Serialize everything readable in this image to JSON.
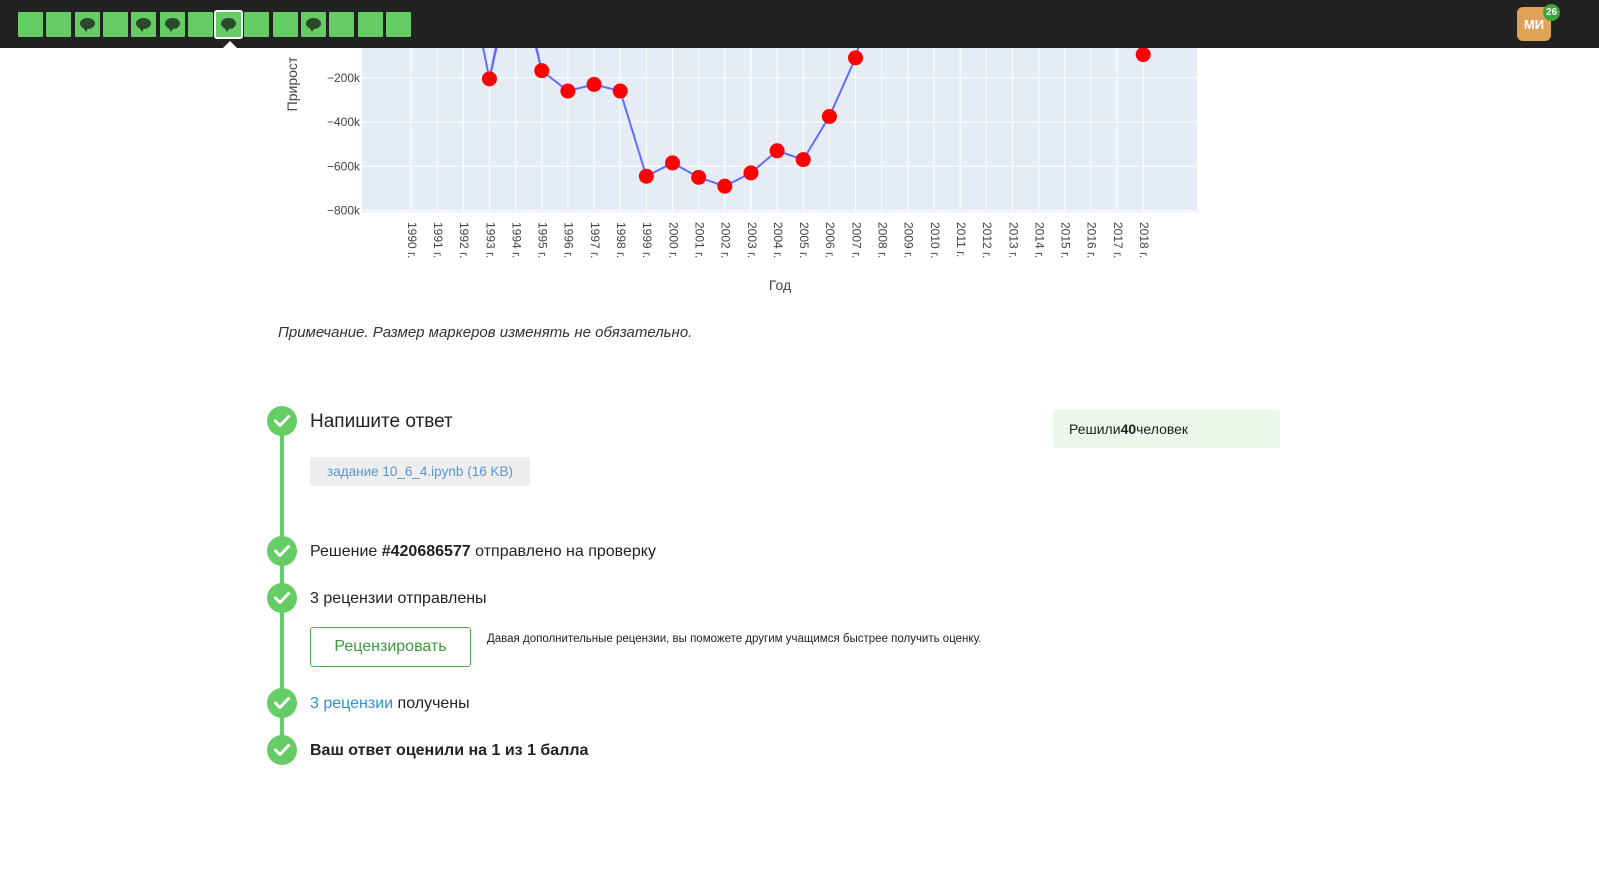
{
  "topbar": {
    "steps": [
      {
        "kind": "plain"
      },
      {
        "kind": "plain"
      },
      {
        "kind": "comment"
      },
      {
        "kind": "plain"
      },
      {
        "kind": "comment"
      },
      {
        "kind": "comment"
      },
      {
        "kind": "plain"
      },
      {
        "kind": "comment",
        "active": true
      },
      {
        "kind": "plain"
      },
      {
        "kind": "plain"
      },
      {
        "kind": "comment"
      },
      {
        "kind": "plain"
      },
      {
        "kind": "plain"
      },
      {
        "kind": "plain"
      }
    ],
    "avatar_initials": "МИ",
    "notification_count": "26"
  },
  "chart_data": {
    "type": "line",
    "xlabel": "Год",
    "ylabel": "Прирост",
    "y_ticks": [
      "−200k",
      "−400k",
      "−600k",
      "−800k"
    ],
    "y_tick_values": [
      -200000,
      -400000,
      -600000,
      -800000
    ],
    "categories": [
      "1990 г.",
      "1991 г.",
      "1992 г.",
      "1993 г.",
      "1994 г.",
      "1995 г.",
      "1996 г.",
      "1997 г.",
      "1998 г.",
      "1999 г.",
      "2000 г.",
      "2001 г.",
      "2002 г.",
      "2003 г.",
      "2004 г.",
      "2005 г.",
      "2006 г.",
      "2007 г.",
      "2008 г.",
      "2009 г.",
      "2010 г.",
      "2011 г.",
      "2012 г.",
      "2013 г.",
      "2014 г.",
      "2015 г.",
      "2016 г.",
      "2017 г.",
      "2018 г."
    ],
    "values": [
      null,
      null,
      null,
      -205000,
      null,
      -168000,
      -260000,
      -230000,
      -260000,
      -645000,
      -585000,
      -650000,
      -690000,
      -630000,
      -530000,
      -570000,
      -375000,
      -110000,
      null,
      null,
      null,
      null,
      null,
      null,
      null,
      null,
      null,
      null,
      -95000
    ],
    "offscreen_neighbors": {
      "1992 г.": "above",
      "1994 г.": "above",
      "2008 г.": "above"
    },
    "line_color": "#636efa",
    "marker_color": "#ff0000",
    "plot_bg": "#e5ecf6"
  },
  "note": "Примечание. Размер маркеров изменять не обязательно.",
  "timeline": {
    "answer_title": "Напишите ответ",
    "file_label": "задание 10_6_4.ipynb (16 KB)",
    "submission_prefix": "Решение ",
    "submission_id": "#420686577",
    "submission_suffix": " отправлено на проверку",
    "reviews_sent": "3 рецензии отправлены",
    "review_button": "Рецензировать",
    "review_hint": "Давая дополнительные рецензии, вы поможете другим учащимся быстрее получить оценку.",
    "reviews_received_link": "3 рецензии",
    "reviews_received_suffix": " получены",
    "score_text": "Ваш ответ оценили на 1 из 1 балла"
  },
  "solved": {
    "prefix": "Решили ",
    "count": "40",
    "suffix": " человек"
  }
}
